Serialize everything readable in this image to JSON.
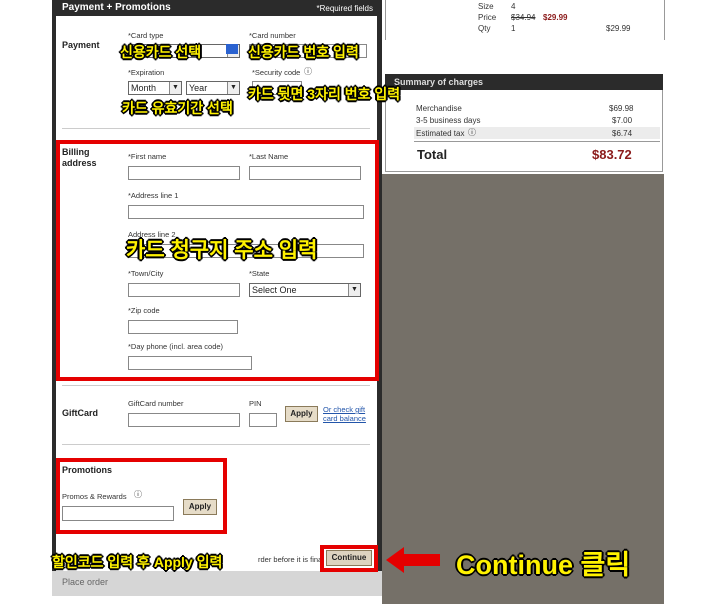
{
  "header": {
    "title": "Payment + Promotions",
    "required_note": "*Required fields"
  },
  "payment": {
    "section_label": "Payment",
    "card_type_label": "*Card type",
    "card_number_label": "*Card number",
    "expiration_label": "*Expiration",
    "month_value": "Month",
    "year_value": "Year",
    "security_code_label": "*Security code"
  },
  "billing": {
    "section_label": "Billing address",
    "first_name_label": "*First name",
    "last_name_label": "*Last Name",
    "address1_label": "*Address line 1",
    "address2_label": "Address line 2",
    "town_label": "*Town/City",
    "state_label": "*State",
    "state_value": "Select One",
    "zip_label": "*Zip code",
    "phone_label": "*Day phone (incl. area code)"
  },
  "giftcard": {
    "section_label": "GiftCard",
    "number_label": "GiftCard number",
    "pin_label": "PIN",
    "apply_label": "Apply",
    "link_text": "Or check gift card balance"
  },
  "promotions": {
    "section_label": "Promotions",
    "promos_label": "Promos & Rewards",
    "apply_label": "Apply"
  },
  "footer": {
    "review_text": "rder before it is final",
    "continue_label": "Continue",
    "place_order": "Place order"
  },
  "order_item": {
    "size_label": "Size",
    "size_value": "4",
    "price_label": "Price",
    "price_old": "$34.94",
    "price_new": "$29.99",
    "qty_label": "Qty",
    "qty_value": "1",
    "line_total": "$29.99"
  },
  "summary": {
    "title": "Summary of charges",
    "rows": [
      {
        "label": "Merchandise",
        "value": "$69.98"
      },
      {
        "label": "3-5 business days",
        "value": "$7.00"
      },
      {
        "label": "Estimated tax",
        "value": "$6.74"
      }
    ],
    "total_label": "Total",
    "total_value": "$83.72"
  },
  "annotations": {
    "card_type": "신용카드 선택",
    "card_number": "신용카드 번호 입력",
    "security": "카드 뒷면 3자리 번호 입력",
    "expiration": "카드 유효기간 선택",
    "billing": "카드 청구지 주소 입력",
    "promo": "할인코드 입력 후 Apply 입력",
    "continue": "Continue 클릭"
  },
  "colors": {
    "annotation_red": "#e50000",
    "annotation_yellow": "#fff200",
    "total_red": "#8b1a1a"
  }
}
